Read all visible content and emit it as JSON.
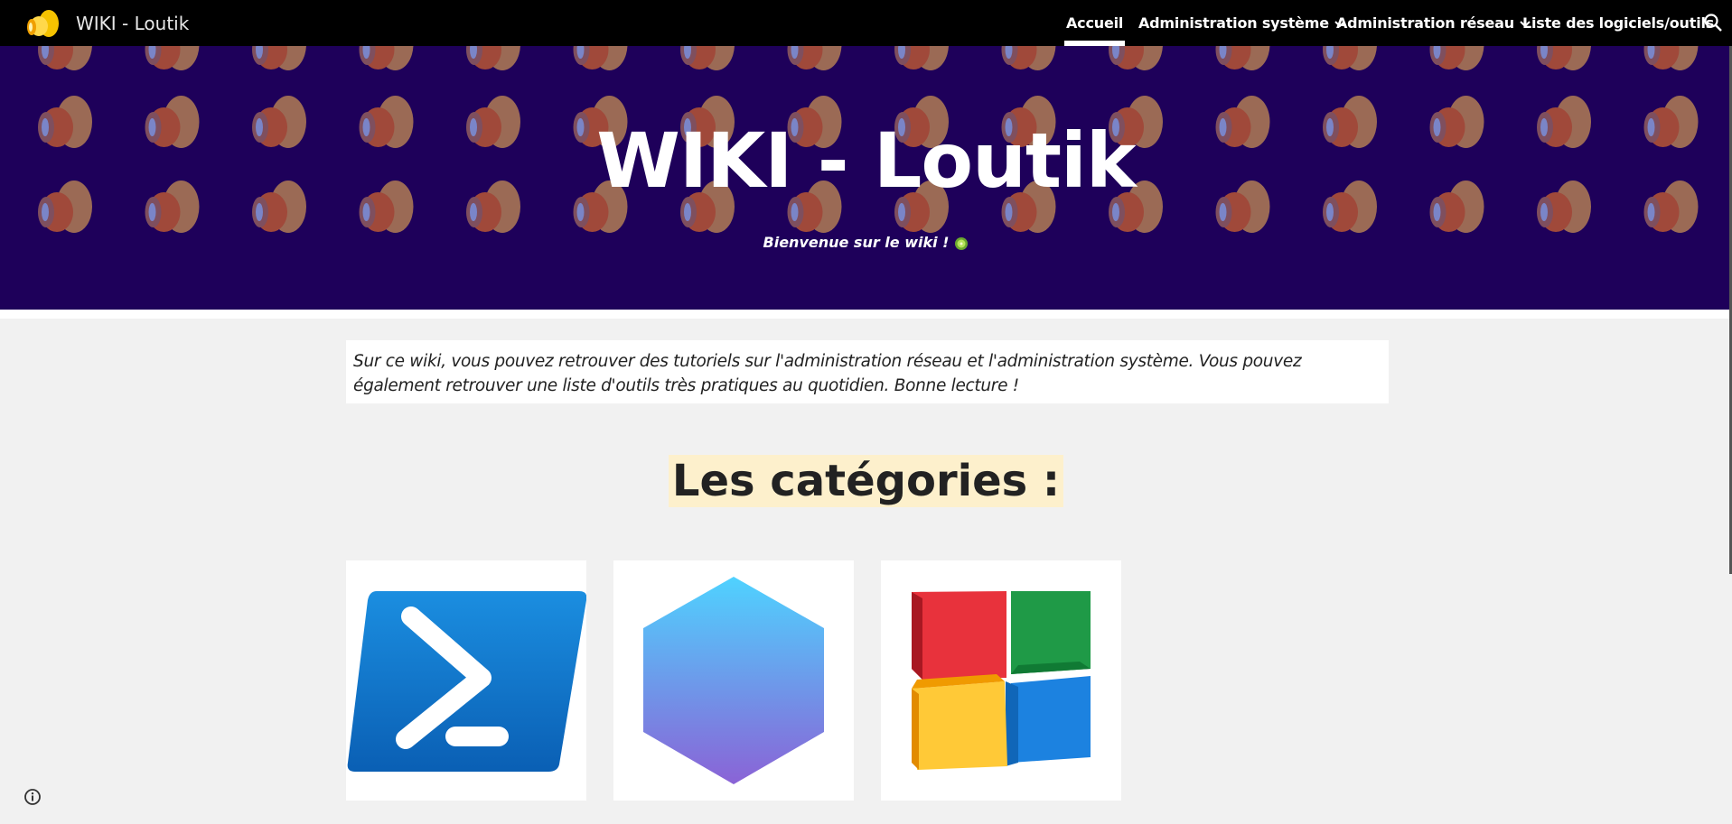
{
  "header": {
    "site_title": "WIKI - Loutik",
    "nav": [
      {
        "label": "Accueil",
        "active": true
      },
      {
        "label": "Administration système",
        "dropdown": true
      },
      {
        "label": "Administration réseau",
        "dropdown": true
      },
      {
        "label": "Liste des logiciels/outils"
      }
    ],
    "search_icon": "search-icon"
  },
  "hero": {
    "title": "WIKI - Loutik",
    "subtitle": "Bienvenue sur le wiki !",
    "background": "#1e005a"
  },
  "intro": {
    "text": "Sur ce wiki, vous pouvez retrouver des tutoriels sur l'administration réseau et l'administration système. Vous pouvez également retrouver une liste d'outils très pratiques au quotidien. Bonne lecture !"
  },
  "categories": {
    "heading": "Les catégories :",
    "cards": [
      {
        "icon": "powershell-icon"
      },
      {
        "icon": "hexagon-icon"
      },
      {
        "icon": "windows-blocks-icon"
      }
    ]
  },
  "footer": {
    "info_icon": "info-icon"
  }
}
